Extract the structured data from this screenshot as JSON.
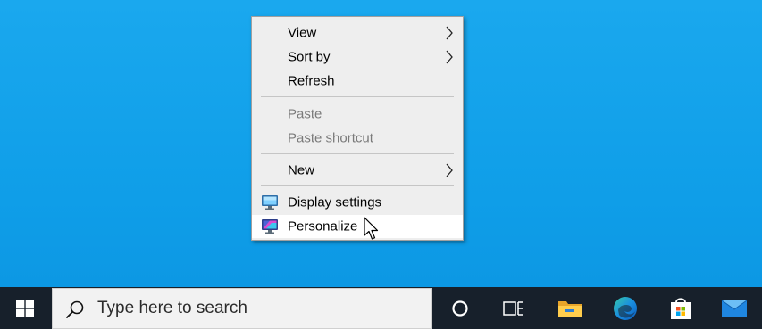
{
  "context_menu": {
    "items": [
      {
        "label": "View",
        "has_submenu": true,
        "enabled": true
      },
      {
        "label": "Sort by",
        "has_submenu": true,
        "enabled": true
      },
      {
        "label": "Refresh",
        "has_submenu": false,
        "enabled": true
      },
      {
        "label": "Paste",
        "has_submenu": false,
        "enabled": false
      },
      {
        "label": "Paste shortcut",
        "has_submenu": false,
        "enabled": false
      },
      {
        "label": "New",
        "has_submenu": true,
        "enabled": true
      },
      {
        "label": "Display settings",
        "icon": "display-settings-icon",
        "has_submenu": false,
        "enabled": true
      },
      {
        "label": "Personalize",
        "icon": "personalize-icon",
        "has_submenu": false,
        "enabled": true,
        "hovered": true
      }
    ]
  },
  "taskbar": {
    "start_icon": "windows-logo-icon",
    "search_placeholder": "Type here to search",
    "buttons": [
      {
        "name": "cortana",
        "icon": "cortana-circle-icon"
      },
      {
        "name": "task-view",
        "icon": "task-view-icon"
      },
      {
        "name": "file-explorer",
        "icon": "folder-icon"
      },
      {
        "name": "edge",
        "icon": "edge-icon"
      },
      {
        "name": "store",
        "icon": "store-bag-icon"
      },
      {
        "name": "mail",
        "icon": "mail-icon"
      }
    ]
  },
  "colors": {
    "desktop": "#0f9ee8",
    "taskbar": "#17202b",
    "menu_bg": "#eeeeee",
    "menu_hover": "#ffffff",
    "disabled_text": "#7a7a7a"
  }
}
